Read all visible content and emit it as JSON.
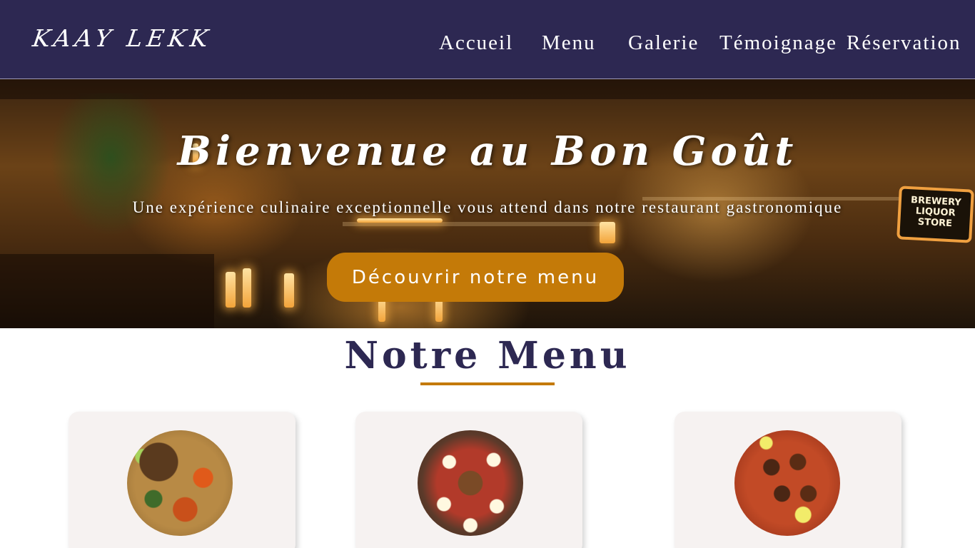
{
  "brand": {
    "logo_text": "KAAY LEKK"
  },
  "nav": {
    "items": [
      {
        "label": "Accueil"
      },
      {
        "label": "Menu"
      },
      {
        "label": "Galerie"
      },
      {
        "label": "Témoignage"
      },
      {
        "label": "Réservation"
      }
    ]
  },
  "hero": {
    "title": "Bienvenue au Bon Goût",
    "subtitle": "Une expérience culinaire exceptionnelle vous attend dans notre restaurant gastronomique",
    "cta_label": "Découvrir notre menu",
    "background_image": "restaurant-bar-interior",
    "sign_text": "BREWERY LIQUOR STORE"
  },
  "menu_section": {
    "title": "Notre Menu",
    "cards": [
      {
        "image": "thieboudienne-dish"
      },
      {
        "image": "mixed-salad-dish"
      },
      {
        "image": "stew-dish"
      }
    ]
  },
  "colors": {
    "navbar": "#2d2852",
    "accent": "#c47a08",
    "title": "#2d2852",
    "card_bg": "#f6f2f1"
  }
}
